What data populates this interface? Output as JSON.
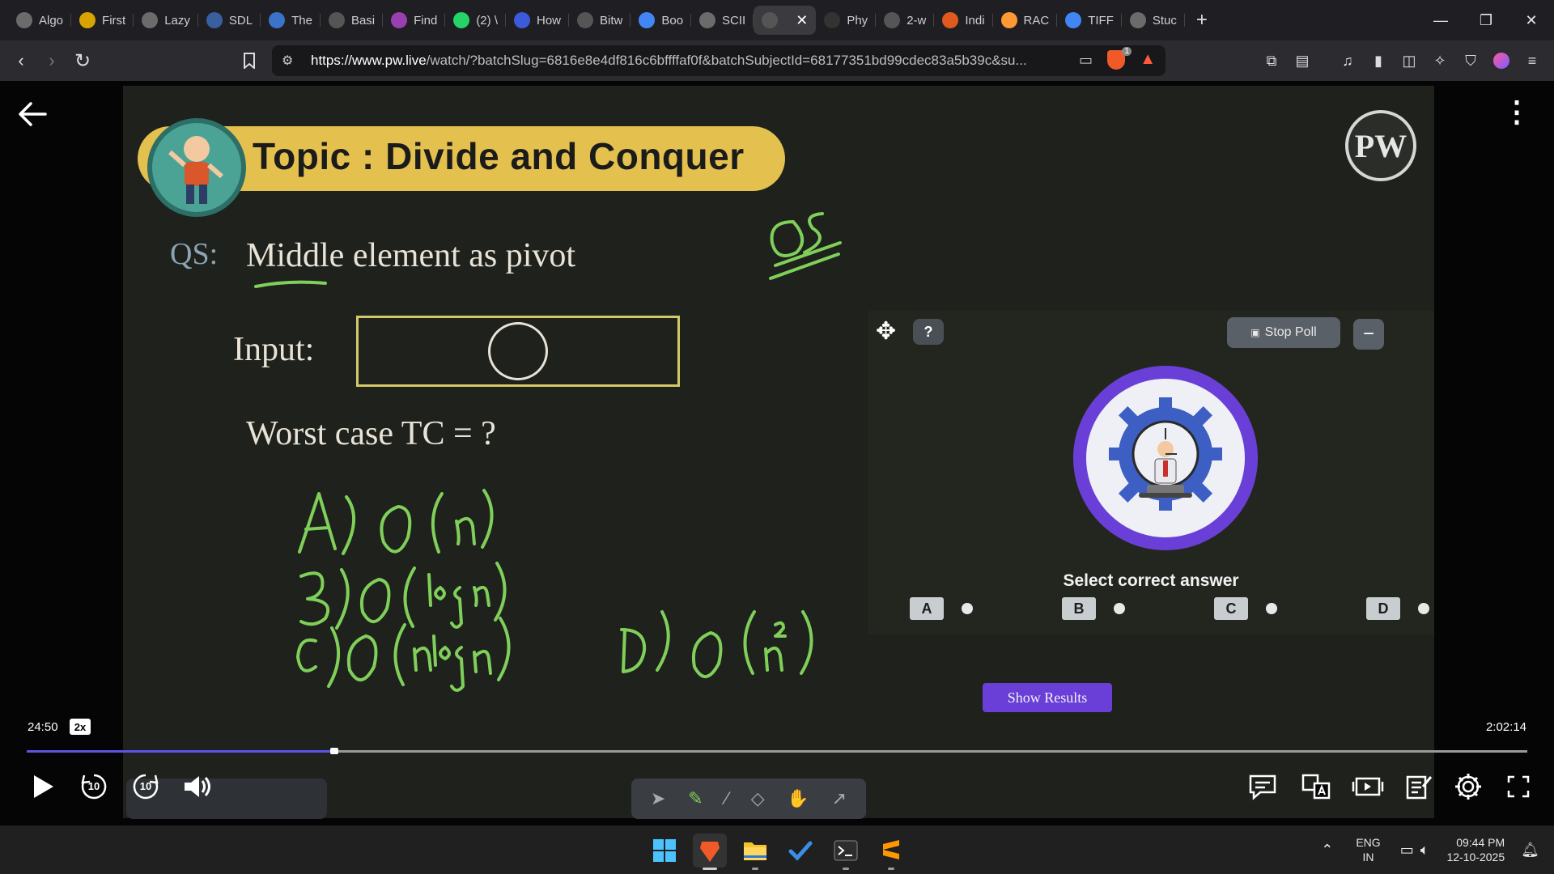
{
  "browser": {
    "tabs": [
      {
        "label": "Algo",
        "favicon": "chatgpt-icon",
        "color": "#6b6b6b"
      },
      {
        "label": "First",
        "favicon": "lightning-icon",
        "color": "#d9a400"
      },
      {
        "label": "Lazy",
        "favicon": "globe-icon",
        "color": "#6b6b6b"
      },
      {
        "label": "SDL",
        "favicon": "sdl-icon",
        "color": "#3a5fa0"
      },
      {
        "label": "The",
        "favicon": "wave-icon",
        "color": "#3a73c9"
      },
      {
        "label": "Basi",
        "favicon": "doc-icon",
        "color": "#555"
      },
      {
        "label": "Find",
        "favicon": "brain-icon",
        "color": "#9a3fb0"
      },
      {
        "label": "(2) \\",
        "favicon": "whatsapp-icon",
        "color": "#25d366"
      },
      {
        "label": "How",
        "favicon": "ribbon-icon",
        "color": "#3b5bdb"
      },
      {
        "label": "Bitw",
        "favicon": "bitwise-icon",
        "color": "#555"
      },
      {
        "label": "Boo",
        "favicon": "google-icon",
        "color": "#4285f4"
      },
      {
        "label": "SCII",
        "favicon": "globe-icon",
        "color": "#6b6b6b"
      },
      {
        "label": "",
        "favicon": "pw-icon",
        "color": "#555"
      },
      {
        "label": "Phy",
        "favicon": "wiki-icon",
        "color": "#333"
      },
      {
        "label": "2-w",
        "favicon": "openai-icon",
        "color": "#555"
      },
      {
        "label": "Indi",
        "favicon": "burger-icon",
        "color": "#e05a1f"
      },
      {
        "label": "RAC",
        "favicon": "india-flag-icon",
        "color": "#ff9933"
      },
      {
        "label": "TIFF",
        "favicon": "google-icon",
        "color": "#4285f4"
      },
      {
        "label": "Stuc",
        "favicon": "globe-icon",
        "color": "#6b6b6b"
      }
    ],
    "active_tab_index": 12,
    "url_host": "https://www.pw.live",
    "url_rest": "/watch/?batchSlug=6816e8e4df816c6bffffaf0f&batchSubjectId=68177351bd99cdec83a5b39c&su...",
    "brave_badge": "1"
  },
  "lecture": {
    "topic": "Topic : Divide and Conquer",
    "logo_text": "PW",
    "qs_label": "QS:",
    "qs_text": "Middle element as pivot",
    "input_label": "Input:",
    "worst_case": "Worst case TC = ?"
  },
  "poll": {
    "stop_label": "Stop Poll",
    "minimize_label": "−",
    "help_label": "?",
    "caption": "Select correct answer",
    "options": [
      "A",
      "B",
      "C",
      "D"
    ],
    "show_results_label": "Show Results",
    "accent": "#6a3fd8"
  },
  "player": {
    "current_time": "24:50",
    "speed": "2x",
    "total_time": "2:02:14",
    "progress_fraction": 0.2035,
    "rewind_label": "10",
    "forward_label": "10"
  },
  "taskbar": {
    "lang_line1": "ENG",
    "lang_line2": "IN",
    "time": "09:44 PM",
    "date": "12-10-2025"
  }
}
